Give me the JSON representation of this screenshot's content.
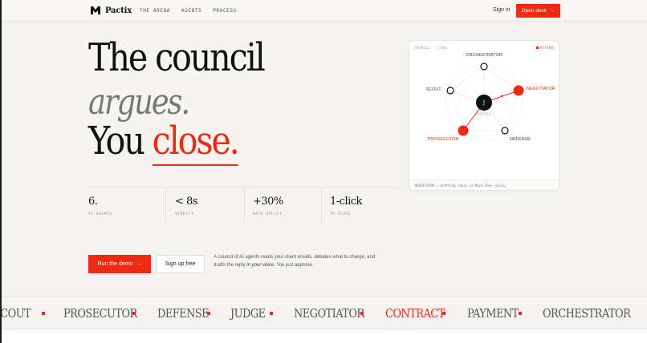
{
  "header": {
    "brand": "Pactix",
    "links": [
      "THE ARENA",
      "AGENTS",
      "PROCESS"
    ],
    "sign_in": "Sign in",
    "open_desk": "Open desk",
    "arrow": "→"
  },
  "hero": {
    "line1": "The council",
    "line2": "argues.",
    "line3_prefix": "You ",
    "line3_accent": "close.",
    "description_pre": "A council of AI agents reads your client emails, debates what to charge, and drafts the reply ",
    "description_em": "in your voice",
    "description_post": ". You just approve."
  },
  "stats": [
    {
      "value": "6.",
      "label": "AI AGENTS"
    },
    {
      "value": "< 8s",
      "label": "VERDICT"
    },
    {
      "value": "+30%",
      "label": "RATE UPLIFT"
    },
    {
      "value": "1-click",
      "label": "TO CLOSE"
    }
  ],
  "cta": {
    "demo": "Run the demo",
    "arrow": "→",
    "signup": "Sign up free"
  },
  "arena": {
    "header": "COUNCIL · LIVE",
    "status": "ACTIVE",
    "center": "J",
    "center_label": "JUDGE",
    "nodes": {
      "orchestrator": "ORCHESTRATOR",
      "scout": "SCOUT",
      "negotiator": "NEGOTIATOR",
      "prosecutor": "PROSECUTOR",
      "defense": "DEFENSE"
    },
    "footer": "NEGOTIATOR → drafting reply in Maya Chen voice…",
    "accent_color": "#ee2a12"
  },
  "marquee": {
    "items": [
      "SCOUT",
      "PROSECUTOR",
      "DEFENSE",
      "JUDGE",
      "NEGOTIATOR",
      "CONTRACT",
      "PAYMENT",
      "ORCHESTRATOR"
    ],
    "highlighted": "CONTRACT"
  }
}
